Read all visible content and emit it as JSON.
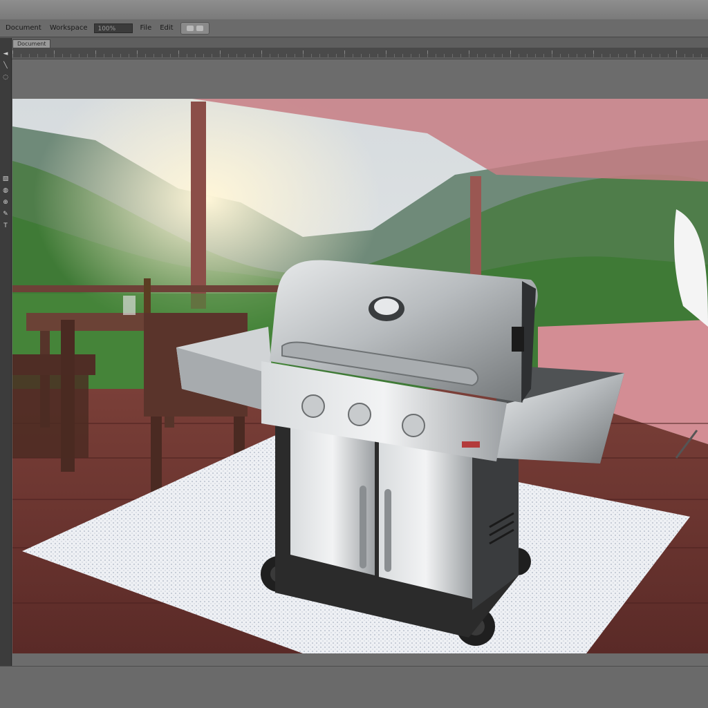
{
  "toolbar": {
    "items": [
      "Document",
      "Workspace",
      "File",
      "Edit"
    ],
    "zoom_field": "100%"
  },
  "optionsbar": {
    "doc_tab": "Document"
  },
  "tools": [
    "move-tool",
    "brush-tool",
    "lasso-tool",
    "crop-tool",
    "heal-tool",
    "stamp-tool",
    "pen-tool",
    "text-tool"
  ],
  "canvas": {
    "subject": "stainless steel gas grill on patio deck"
  }
}
